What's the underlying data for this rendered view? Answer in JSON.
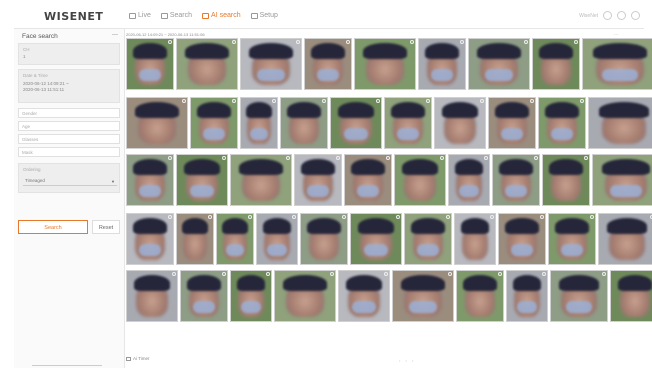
{
  "header": {
    "logo": "WISENET",
    "nav": [
      {
        "label": "Live",
        "icon": "monitor-icon",
        "active": false
      },
      {
        "label": "Search",
        "icon": "search-icon",
        "active": false
      },
      {
        "label": "AI search",
        "icon": "ai-search-icon",
        "active": true
      },
      {
        "label": "Setup",
        "icon": "gear-icon",
        "active": false
      }
    ],
    "user": "WiseNet"
  },
  "panel": {
    "title": "Face search",
    "collapse": "—",
    "ch_label": "CH",
    "ch_value": "1",
    "date_label": "Date & Time",
    "date_value_1": "2020-06-12 14:09:21 ~",
    "date_value_2": "2020-06-13 11:51:11",
    "gender": "Gender",
    "age": "Age",
    "glasses": "Glasses",
    "mask": "Mask",
    "ordering_label": "Ordering",
    "ordering_value": "Timeaged",
    "search_label": "Search",
    "reset_label": "Reset"
  },
  "results": {
    "range": "2020-06-12 14:09:21 ~ 2020-06-13 11:51:06",
    "dots": "...",
    "export_label": "Ai Timer",
    "pager": "• • •"
  },
  "colors": {
    "accent": "#e8782c"
  }
}
